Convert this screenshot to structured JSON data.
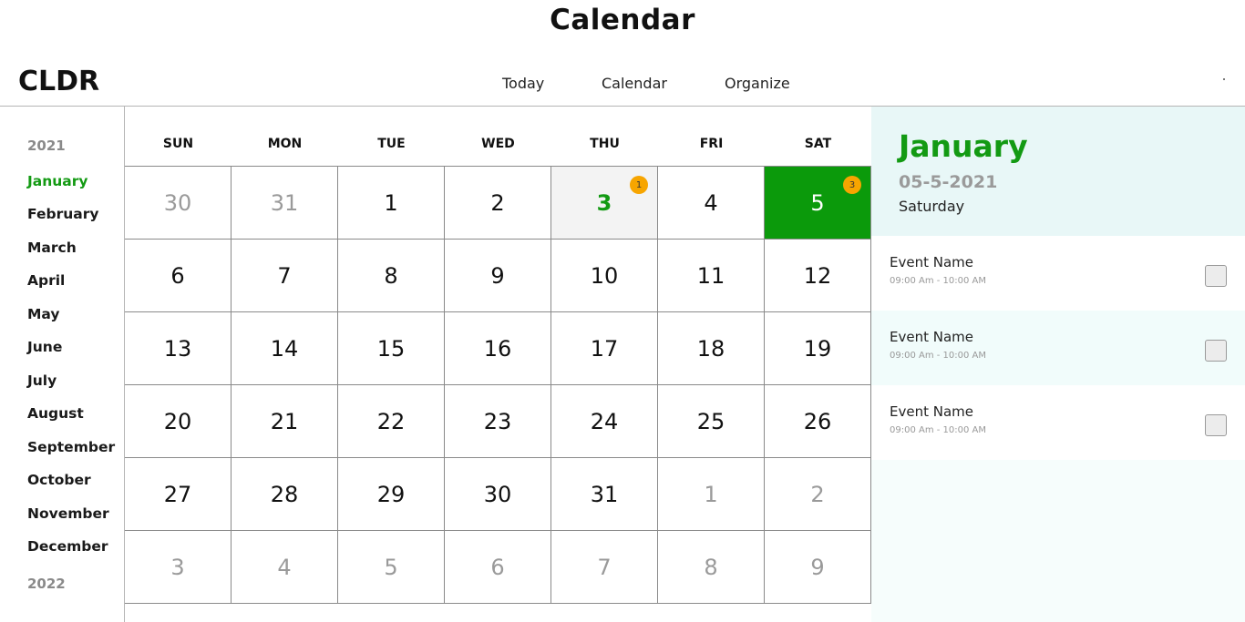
{
  "page": {
    "title": "Calendar"
  },
  "header": {
    "logo": "CLDR",
    "nav": [
      "Today",
      "Calendar",
      "Organize"
    ]
  },
  "sidebar": {
    "year_current": "2021",
    "year_next": "2022",
    "months": [
      "January",
      "February",
      "March",
      "April",
      "May",
      "June",
      "July",
      "August",
      "September",
      "October",
      "November",
      "December"
    ],
    "active_month": "January"
  },
  "calendar": {
    "weekdays": [
      "SUN",
      "MON",
      "TUE",
      "WED",
      "THU",
      "FRI",
      "SAT"
    ],
    "days": [
      {
        "d": "30",
        "muted": true
      },
      {
        "d": "31",
        "muted": true
      },
      {
        "d": "1"
      },
      {
        "d": "2"
      },
      {
        "d": "3",
        "today": true,
        "badge": "1"
      },
      {
        "d": "4"
      },
      {
        "d": "5",
        "selected": true,
        "badge": "3"
      },
      {
        "d": "6"
      },
      {
        "d": "7"
      },
      {
        "d": "8"
      },
      {
        "d": "9"
      },
      {
        "d": "10"
      },
      {
        "d": "11"
      },
      {
        "d": "12"
      },
      {
        "d": "13"
      },
      {
        "d": "14"
      },
      {
        "d": "15"
      },
      {
        "d": "16"
      },
      {
        "d": "17"
      },
      {
        "d": "18"
      },
      {
        "d": "19"
      },
      {
        "d": "20"
      },
      {
        "d": "21"
      },
      {
        "d": "22"
      },
      {
        "d": "23"
      },
      {
        "d": "24"
      },
      {
        "d": "25"
      },
      {
        "d": "26"
      },
      {
        "d": "27"
      },
      {
        "d": "28"
      },
      {
        "d": "29"
      },
      {
        "d": "30"
      },
      {
        "d": "31"
      },
      {
        "d": "1",
        "muted": true
      },
      {
        "d": "2",
        "muted": true
      },
      {
        "d": "3",
        "muted": true
      },
      {
        "d": "4",
        "muted": true
      },
      {
        "d": "5",
        "muted": true
      },
      {
        "d": "6",
        "muted": true
      },
      {
        "d": "7",
        "muted": true
      },
      {
        "d": "8",
        "muted": true
      },
      {
        "d": "9",
        "muted": true
      }
    ]
  },
  "selected_date": {
    "month": "January",
    "date": "05-5-2021",
    "weekday": "Saturday"
  },
  "events": [
    {
      "name": "Event Name",
      "time": "09:00 Am - 10:00 AM"
    },
    {
      "name": "Event Name",
      "time": "09:00 Am - 10:00 AM"
    },
    {
      "name": "Event Name",
      "time": "09:00 Am - 10:00 AM"
    }
  ],
  "colors": {
    "accent_green": "#139a13",
    "selected_bg": "#0b9a0b",
    "badge": "#f7a500",
    "panel_bg": "#e8f7f7"
  }
}
